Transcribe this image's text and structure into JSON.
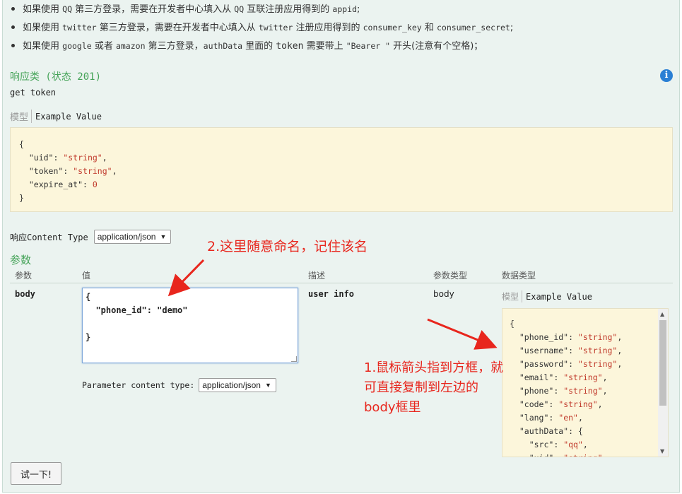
{
  "notes": [
    {
      "prefix": "如果使用 ",
      "code1": "QQ",
      "mid": " 第三方登录，需要在开发者中心填入从 ",
      "code2": "QQ",
      "suffix": " 互联注册应用得到的 ",
      "code3": "appid",
      "end": ";"
    },
    {
      "prefix": "如果使用 ",
      "code1": "twitter",
      "mid": " 第三方登录，需要在开发者中心填入从 ",
      "code2": "twitter",
      "suffix": " 注册应用得到的 ",
      "code3": "consumer_key",
      "end": " 和 ",
      "code4": "consumer_secret",
      "end2": ";"
    },
    {
      "prefix": "如果使用 ",
      "code1": "google",
      "mid": " 或者 ",
      "code2": "amazon",
      "suffix": " 第三方登录，",
      "code3": "authData",
      "end": " 里面的 ",
      "code4": "token",
      "end2": " 需要带上 ",
      "code5": "\"Bearer \"",
      "end3": " 开头(注意有个空格)；"
    }
  ],
  "response": {
    "title": "响应类 (状态 201)",
    "description": "get token",
    "tab_model": "模型",
    "tab_example": "Example Value",
    "example_lines": [
      "{",
      "  \"uid\": \"string\",",
      "  \"token\": \"string\",",
      "  \"expire_at\": 0",
      "}"
    ],
    "content_type_label": "响应Content Type",
    "content_type_value": "application/json"
  },
  "params": {
    "title": "参数",
    "headers": {
      "param": "参数",
      "value": "值",
      "desc": "描述",
      "param_type": "参数类型",
      "data_type": "数据类型"
    },
    "row": {
      "name": "body",
      "textarea_value": "{\n  \"phone_id\": \"demo\"\n\n}",
      "desc": "user info",
      "param_type": "body",
      "parameter_content_type_label": "Parameter content type:",
      "parameter_content_type_value": "application/json",
      "dt_tab_model": "模型",
      "dt_tab_example": "Example Value",
      "dt_example_lines": [
        "{",
        "  \"phone_id\": \"string\",",
        "  \"username\": \"string\",",
        "  \"password\": \"string\",",
        "  \"email\": \"string\",",
        "  \"phone\": \"string\",",
        "  \"code\": \"string\",",
        "  \"lang\": \"en\",",
        "  \"authData\": {",
        "    \"src\": \"qq\",",
        "    \"uid\": \"string\","
      ]
    }
  },
  "try_button": "试一下!",
  "annotations": {
    "one": "1.鼠标箭头指到方框，就可直接复制到左边的body框里",
    "two": "2.这里随意命名，记住该名"
  },
  "colors": {
    "accent_green": "#45a358",
    "annotation_red": "#e8261d",
    "info_blue": "#2a7fd4",
    "code_bg": "#fcf6db"
  }
}
